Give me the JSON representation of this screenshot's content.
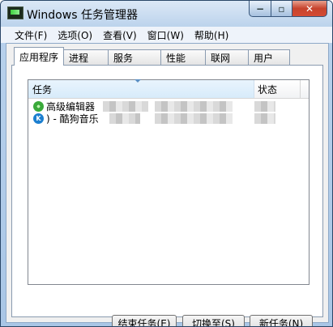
{
  "window": {
    "title": "Windows 任务管理器"
  },
  "caption": {
    "min": "−",
    "max": "▫",
    "close": "✕"
  },
  "menu": [
    "文件(F)",
    "选项(O)",
    "查看(V)",
    "窗口(W)",
    "帮助(H)"
  ],
  "tabs": [
    {
      "label": "应用程序",
      "active": true
    },
    {
      "label": "进程"
    },
    {
      "label": "服务"
    },
    {
      "label": "性能"
    },
    {
      "label": "联网"
    },
    {
      "label": "用户"
    }
  ],
  "list": {
    "columns": {
      "task": "任务",
      "status": "状态"
    },
    "rows": [
      {
        "icon": "ie-icon",
        "text": "高级编辑器"
      },
      {
        "icon": "kugou-icon",
        "badge": "K",
        "text": ") - 酷狗音乐"
      }
    ]
  },
  "buttons": {
    "end_task": "结束任务(E)",
    "switch_to": "切换至(S)",
    "new_task": "新任务(N)"
  }
}
